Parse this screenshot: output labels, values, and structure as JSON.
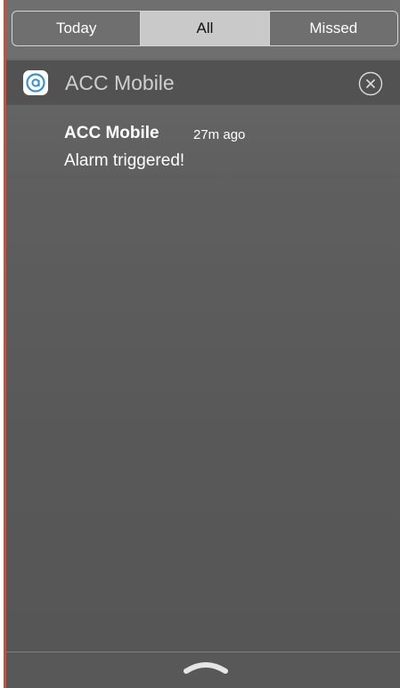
{
  "tabs": [
    {
      "label": "Today",
      "selected": false
    },
    {
      "label": "All",
      "selected": true
    },
    {
      "label": "Missed",
      "selected": false
    }
  ],
  "app_section": {
    "app_name": "ACC Mobile",
    "icon": "acc-mobile-app-icon",
    "close_icon": "close-circle-icon"
  },
  "notification": {
    "title": "ACC Mobile",
    "time": "27m ago",
    "message": "Alarm triggered!"
  },
  "bottom": {
    "handle_icon": "chevron-up-grabber-icon"
  },
  "colors": {
    "panel": "#5f5f5f",
    "header": "#525252",
    "selected_tab": "#c9c9c9",
    "icon_blue": "#3a8fd6"
  }
}
